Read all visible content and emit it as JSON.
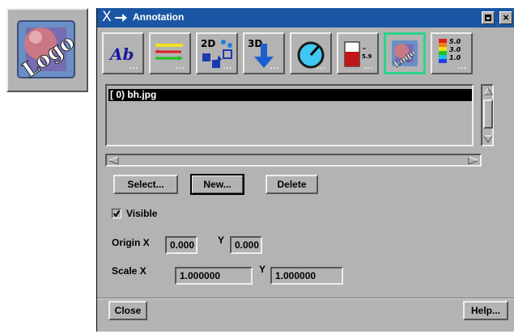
{
  "big_icon": {
    "name": "logo-icon",
    "text": "Logo"
  },
  "window": {
    "title": "Annotation",
    "title_logo": "X",
    "close_glyph": "×"
  },
  "toolbar": {
    "tools": [
      {
        "name": "tool-text",
        "label": "Ab"
      },
      {
        "name": "tool-lines",
        "label": ""
      },
      {
        "name": "tool-2d",
        "label": "2D"
      },
      {
        "name": "tool-3d",
        "label": "3D"
      },
      {
        "name": "tool-dial",
        "label": ""
      },
      {
        "name": "tool-bar",
        "label": "5.9"
      },
      {
        "name": "tool-logo",
        "label": "Logo",
        "selected": true
      },
      {
        "name": "tool-legend",
        "labels": [
          "5.0",
          "3.0",
          "1.0"
        ]
      }
    ],
    "dots": "..."
  },
  "list": {
    "items": [
      "[   0) bh.jpg"
    ]
  },
  "buttons": {
    "select": "Select...",
    "new": "New...",
    "delete": "Delete",
    "close": "Close",
    "help": "Help..."
  },
  "visible": {
    "label": "Visible",
    "checked": true
  },
  "origin": {
    "label": "Origin X",
    "y_label": "Y",
    "x_value": "0.000",
    "y_value": "0.000"
  },
  "scale": {
    "label": "Scale X",
    "y_label": "Y",
    "x_value": "1.000000",
    "y_value": "1.000000"
  },
  "colors": {
    "titlebar": "#1a56a3",
    "panel": "#b3b3b3",
    "selected_tool": "#2fd38a"
  }
}
